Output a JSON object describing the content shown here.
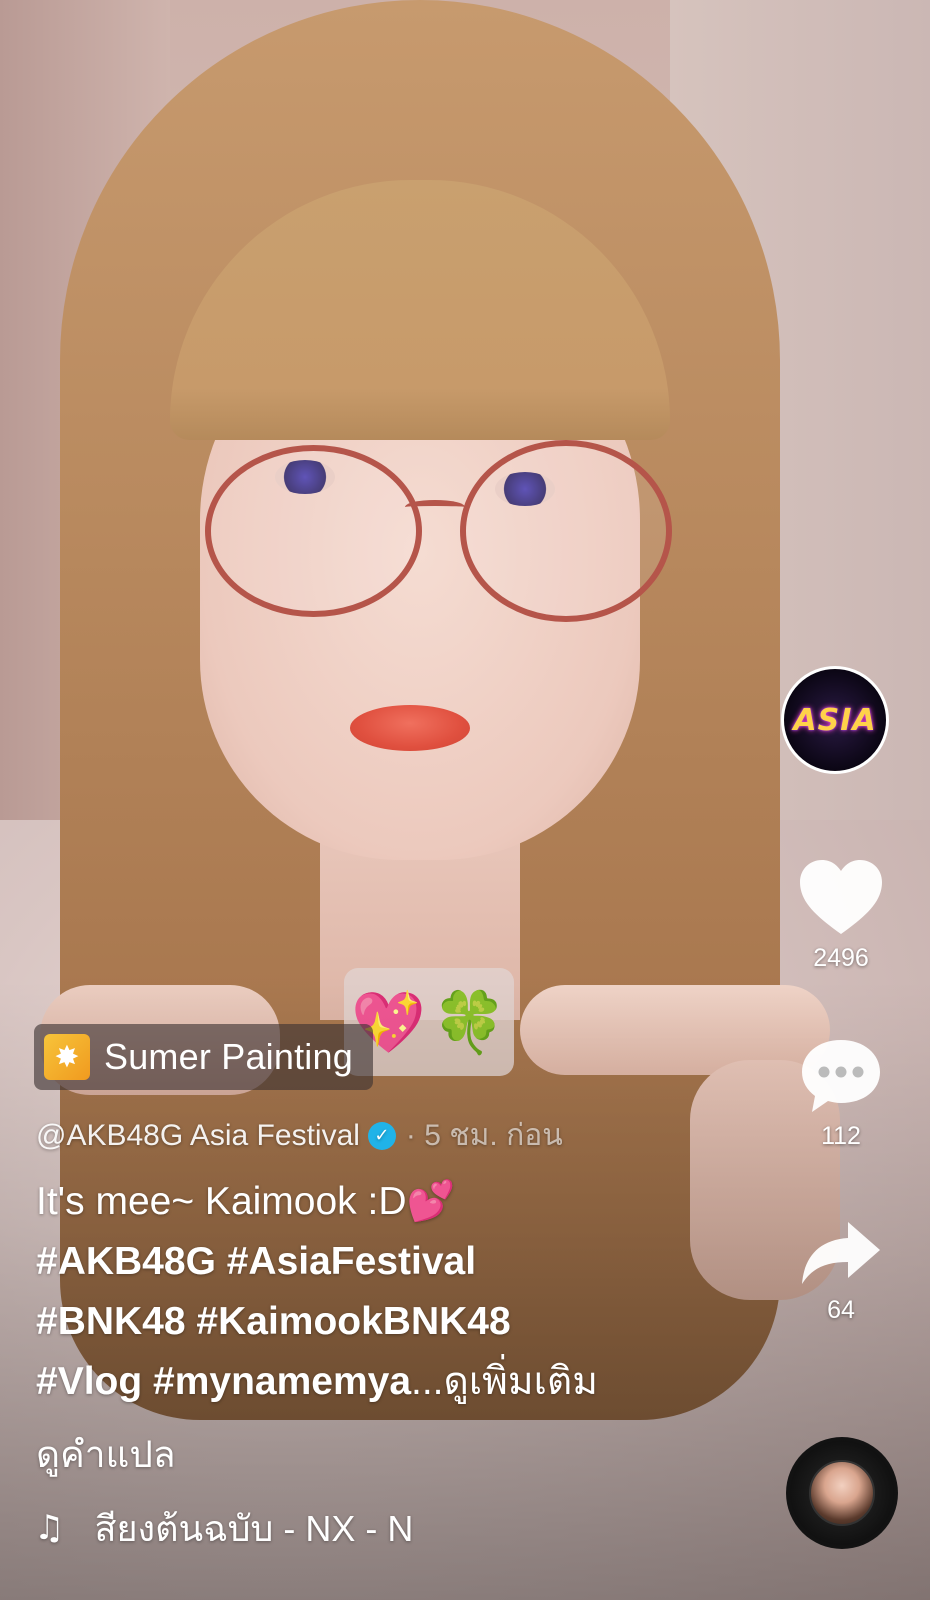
{
  "profile": {
    "avatar_logo": "ASIA"
  },
  "actions": {
    "likes": "2496",
    "comments": "112",
    "shares": "64"
  },
  "effect": {
    "label": "Sumer Painting",
    "icon": "sparkle-burst-icon"
  },
  "post": {
    "author": "@AKB48G Asia Festival",
    "time_ago": "· 5 ชม. ก่อน",
    "caption_text": "It's mee~ Kaimook :D",
    "caption_emoji": "💕",
    "hashtags_line1": "#AKB48G #AsiaFestival",
    "hashtags_line2": "#BNK48 #KaimookBNK48",
    "hashtags_line3": "#Vlog #mynamemya",
    "see_more": "...ดูเพิ่มเติม",
    "translate": "ดูคำแปล"
  },
  "sound": {
    "label": "สียงต้นฉบับ - NX - N",
    "icon": "music-note-icon"
  },
  "sticker": {
    "heart": "💖",
    "clover": "🍀"
  },
  "colors": {
    "verified": "#20b3e8",
    "effect_icon": "#f7c43a"
  }
}
